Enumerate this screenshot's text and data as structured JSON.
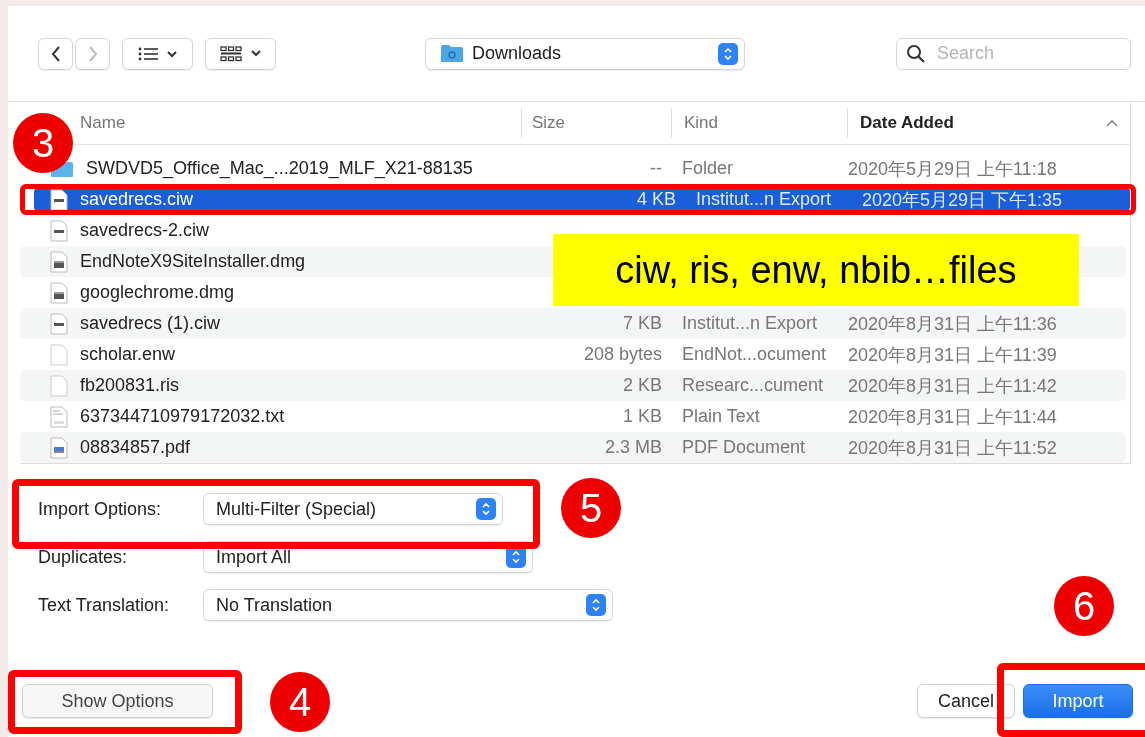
{
  "toolbar": {
    "location": "Downloads",
    "search": {
      "placeholder": "Search"
    }
  },
  "columns": [
    {
      "label": "Name",
      "sorted": false
    },
    {
      "label": "Size",
      "sorted": false
    },
    {
      "label": "Kind",
      "sorted": false
    },
    {
      "label": "Date Added",
      "sorted": true
    }
  ],
  "rows": [
    {
      "kind": "folder",
      "name": "SWDVD5_Office_Mac_...2019_MLF_X21-88135",
      "size": "--",
      "type": "Folder",
      "date": "2020年5月29日 上午11:18",
      "selected": false
    },
    {
      "kind": "endnote",
      "name": "savedrecs.ciw",
      "size": "4 KB",
      "type": "Institut...n Export",
      "date": "2020年5月29日 下午1:35",
      "selected": true
    },
    {
      "kind": "endnote",
      "name": "savedrecs-2.ciw",
      "selected": false
    },
    {
      "kind": "disk",
      "name": "EndNoteX9SiteInstaller.dmg",
      "selected": false
    },
    {
      "kind": "disk",
      "name": "googlechrome.dmg",
      "selected": false
    },
    {
      "kind": "endnote",
      "name": "savedrecs (1).ciw",
      "size": "7 KB",
      "type": "Institut...n Export",
      "date": "2020年8月31日 上午11:36",
      "selected": false
    },
    {
      "kind": "blank",
      "name": "scholar.enw",
      "size": "208 bytes",
      "type": "EndNot...ocument",
      "date": "2020年8月31日 上午11:39",
      "selected": false
    },
    {
      "kind": "blank",
      "name": "fb200831.ris",
      "size": "2 KB",
      "type": "Researc...cument",
      "date": "2020年8月31日 上午11:42",
      "selected": false
    },
    {
      "kind": "text",
      "name": "637344710979172032.txt",
      "size": "1 KB",
      "type": "Plain Text",
      "date": "2020年8月31日 上午11:44",
      "selected": false
    },
    {
      "kind": "pdf",
      "name": "08834857.pdf",
      "size": "2.3 MB",
      "type": "PDF Document",
      "date": "2020年8月31日 上午11:52",
      "selected": false
    }
  ],
  "callout": "ciw, ris, enw, nbib…files",
  "options": [
    {
      "label": "Import Options:",
      "value": "Multi-Filter (Special)"
    },
    {
      "label": "Duplicates:",
      "value": "Import All"
    },
    {
      "label": "Text Translation:",
      "value": "No Translation"
    }
  ],
  "buttons": {
    "show_options": "Show Options",
    "cancel": "Cancel",
    "import": "Import"
  },
  "markers": [
    "3",
    "5",
    "4",
    "6"
  ]
}
